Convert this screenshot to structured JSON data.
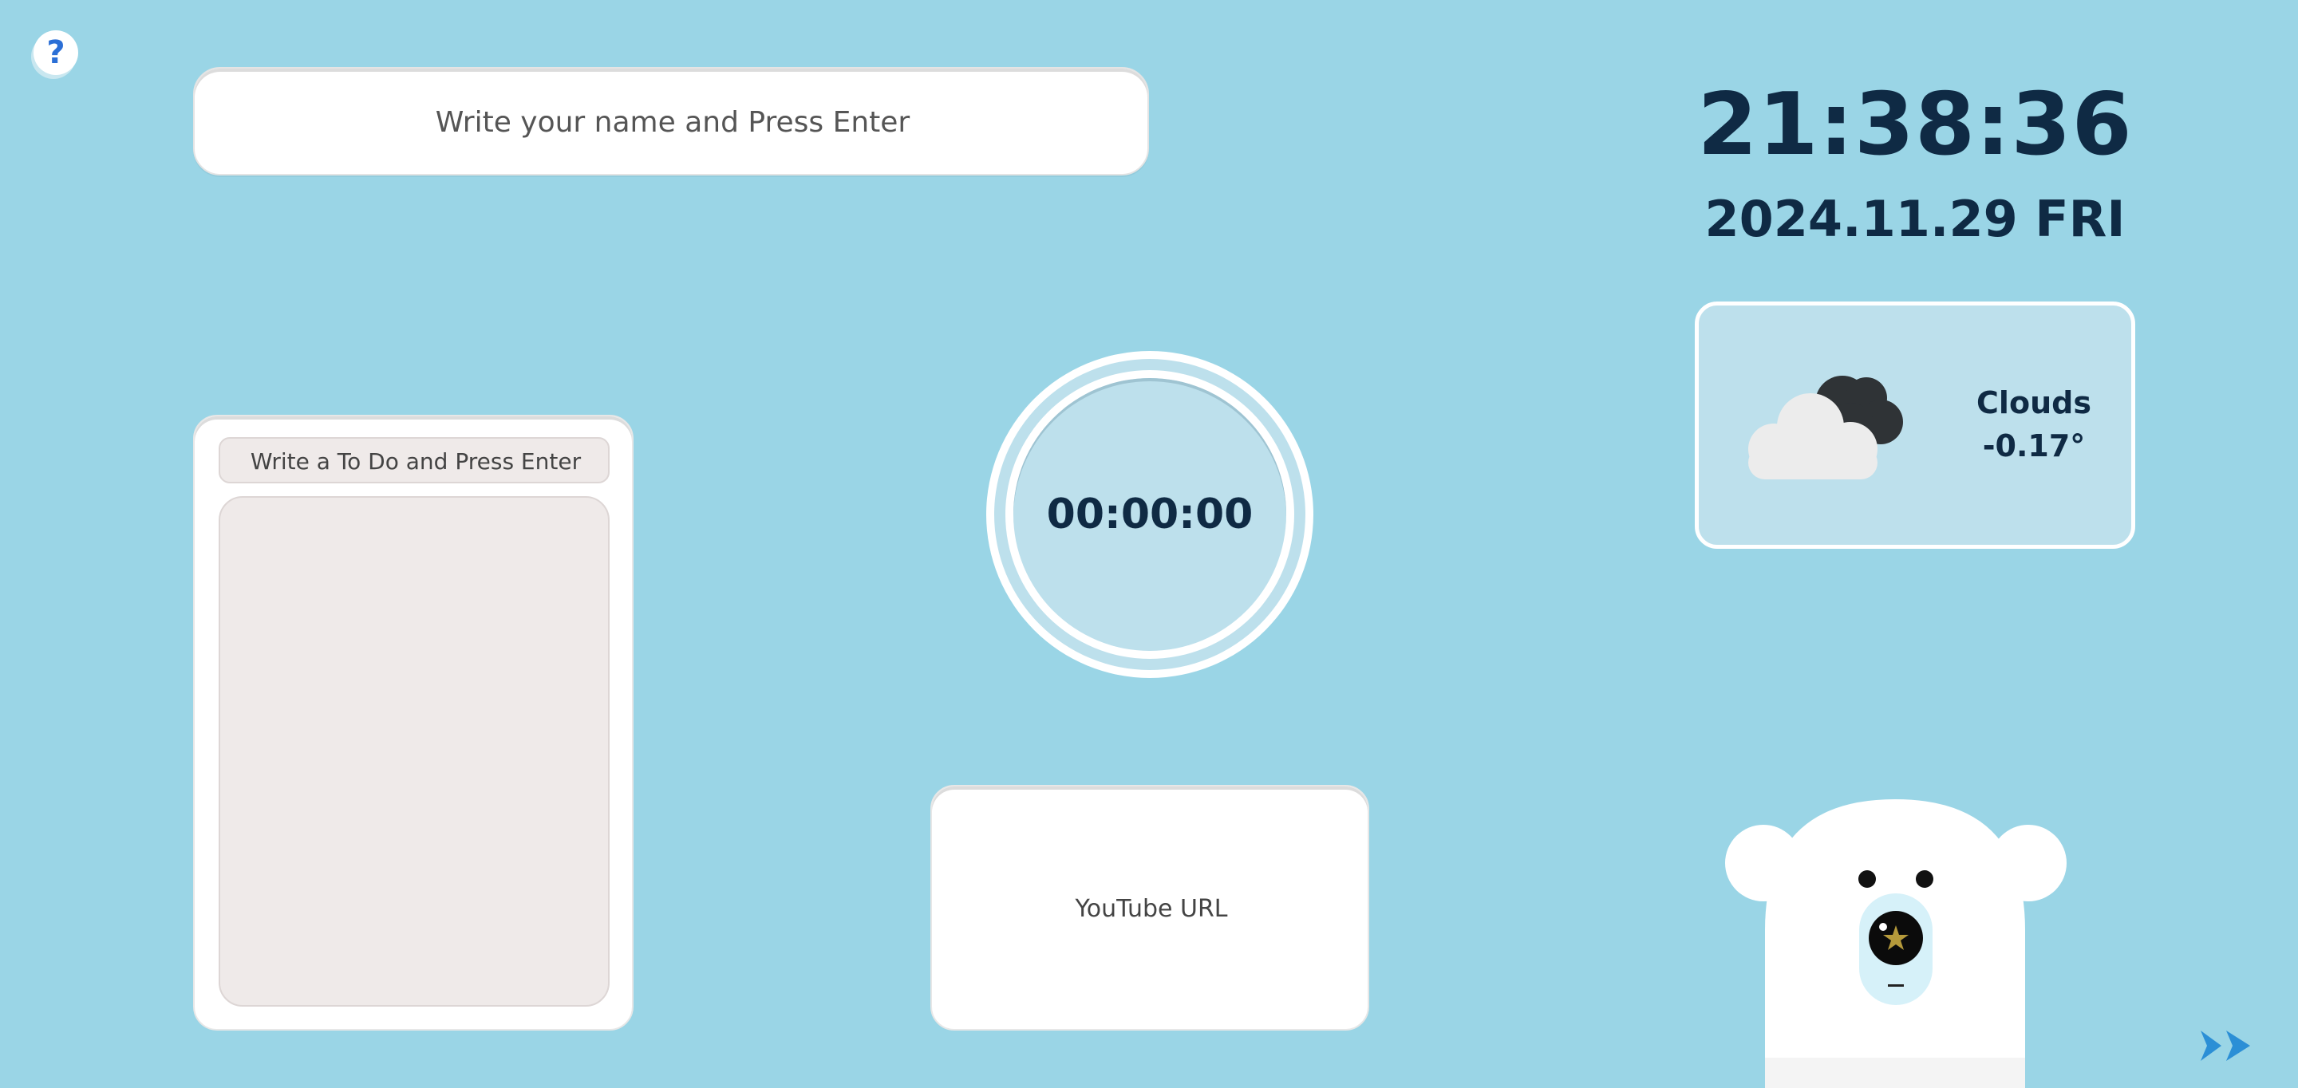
{
  "help": {
    "icon": "help-icon",
    "symbol": "?"
  },
  "name_input": {
    "placeholder": "Write your name and Press Enter",
    "value": ""
  },
  "clock": {
    "time": "21:38:36",
    "date": "2024.11.29 FRI"
  },
  "weather": {
    "icon": "cloud-icon",
    "condition": "Clouds",
    "temperature": "-0.17°"
  },
  "todo": {
    "placeholder": "Write a To Do and Press Enter",
    "value": "",
    "items": []
  },
  "timer": {
    "display": "00:00:00"
  },
  "youtube": {
    "placeholder": "YouTube URL",
    "value": ""
  },
  "bear": {
    "icon": "polar-bear-mascot"
  },
  "next": {
    "icon": "double-chevron-right-icon"
  },
  "colors": {
    "background": "#9ad5e6",
    "panel": "#bde0ec",
    "text_dark": "#0f2a44",
    "accent_blue": "#2b8fd6"
  }
}
